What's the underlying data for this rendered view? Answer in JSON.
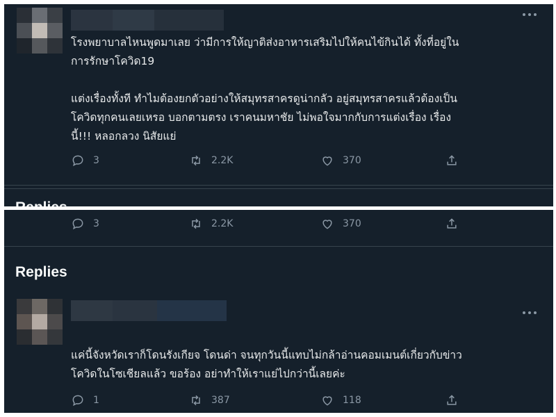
{
  "original_tweet": {
    "text_lines": [
      "โรงพยาบาลไหนพูดมาเลย ว่ามีการให้ญาติส่งอาหารเสริมไปให้คนไข้กินได้ ทั้งที่อยู่ใน",
      "การรักษาโควิด19",
      "",
      "แต่งเรื่องทั้งที ทำไมต้องยกตัวอย่างให้สมุทรสาครดูน่ากลัว อยู่สมุทรสาครแล้วต้องเป็น",
      "โควิดทุกคนเลยเหรอ บอกตามตรง เราคนมหาชัย ไม่พอใจมากกับการแต่งเรื่อง เรื่อง",
      "นี้!!! หลอกลวง นิสัยแย่"
    ],
    "replies_count": "3",
    "retweets_count": "2.2K",
    "likes_count": "370"
  },
  "replies_heading": "Replies",
  "reply": {
    "text_lines": [
      "แค่นี้จังหวัดเราก็โดนรังเกียจ โดนด่า จนทุกวันนี้แทบไม่กล้าอ่านคอมเมนต์เกี่ยวกับข่าว",
      "โควิดในโซเชียลแล้ว ขอร้อง อย่าทำให้เราแย่ไปกว่านี้เลยค่ะ"
    ],
    "replies_count": "1",
    "retweets_count": "387",
    "likes_count": "118"
  },
  "icons": {
    "reply": "reply-icon",
    "retweet": "retweet-icon",
    "like": "heart-icon",
    "share": "share-icon",
    "more": "more-options-icon"
  },
  "colors": {
    "background": "#15202b",
    "text": "#e7e9ea",
    "secondary": "#8b98a5",
    "divider": "#38444d"
  }
}
